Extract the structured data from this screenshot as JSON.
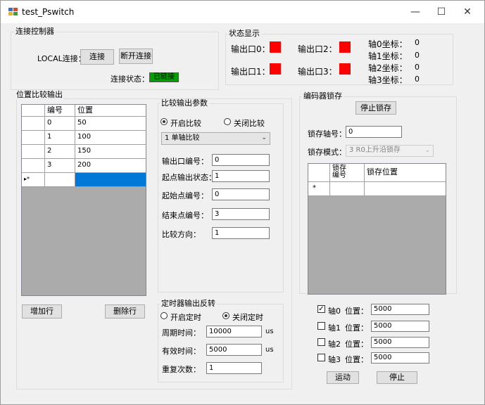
{
  "window": {
    "title": "test_Pswitch",
    "minimize": "—",
    "maximize": "☐",
    "close": "✕"
  },
  "connect": {
    "group_title": "连接控制器",
    "local_label": "LOCAL连接：",
    "connect_button": "连接",
    "disconnect_button": "断开连接",
    "status_label": "连接状态：",
    "status_value": "已链接"
  },
  "status": {
    "group_title": "状态显示",
    "out0": "输出口0：",
    "out1": "输出口1：",
    "out2": "输出口2：",
    "out3": "输出口3：",
    "axis0_label": "轴0坐标：",
    "axis1_label": "轴1坐标：",
    "axis2_label": "轴2坐标：",
    "axis3_label": "轴3坐标：",
    "axis0_value": "0",
    "axis1_value": "0",
    "axis2_value": "0",
    "axis3_value": "0",
    "indicator_color": "#ff0000"
  },
  "position": {
    "group_title": "位置比较输出",
    "col_no": "编号",
    "col_pos": "位置",
    "rows": [
      {
        "no": "0",
        "pos": "50"
      },
      {
        "no": "1",
        "pos": "100"
      },
      {
        "no": "2",
        "pos": "150"
      },
      {
        "no": "3",
        "pos": "200"
      }
    ],
    "new_row_marker": "▸*",
    "add_row_button": "增加行",
    "delete_row_button": "删除行"
  },
  "compare": {
    "group_title": "比较输出参数",
    "enable_label": "开启比较",
    "disable_label": "关闭比较",
    "mode_value": "1 单轴比较",
    "out_no_label": "输出口编号：",
    "out_no_value": "0",
    "start_state_label": "起点输出状态：",
    "start_state_value": "1",
    "start_point_label": "起始点编号：",
    "start_point_value": "0",
    "end_point_label": "结束点编号：",
    "end_point_value": "3",
    "direction_label": "比较方向：",
    "direction_value": "1"
  },
  "timer": {
    "group_title": "定时器输出反转",
    "enable_label": "开启定时",
    "disable_label": "关闭定时",
    "period_label": "周期时间：",
    "period_value": "10000",
    "period_unit": "us",
    "valid_label": "有效时间：",
    "valid_value": "5000",
    "valid_unit": "us",
    "repeat_label": "重复次数：",
    "repeat_value": "1"
  },
  "latch": {
    "group_title": "编码器锁存",
    "stop_button": "停止锁存",
    "axis_label": "锁存轴号：",
    "axis_value": "0",
    "mode_label": "锁存模式：",
    "mode_value": "3 R0上升沿锁存",
    "col_no": "锁存\n编号",
    "col_pos": "锁存位置",
    "new_row_marker": "*"
  },
  "motion": {
    "axes": [
      {
        "label": "轴0",
        "checked": true,
        "pos_label": "位置：",
        "pos_value": "5000"
      },
      {
        "label": "轴1",
        "checked": false,
        "pos_label": "位置：",
        "pos_value": "5000"
      },
      {
        "label": "轴2",
        "checked": false,
        "pos_label": "位置：",
        "pos_value": "5000"
      },
      {
        "label": "轴3",
        "checked": false,
        "pos_label": "位置：",
        "pos_value": "5000"
      }
    ],
    "move_button": "运动",
    "stop_button": "停止",
    "check_mark": "✓"
  }
}
